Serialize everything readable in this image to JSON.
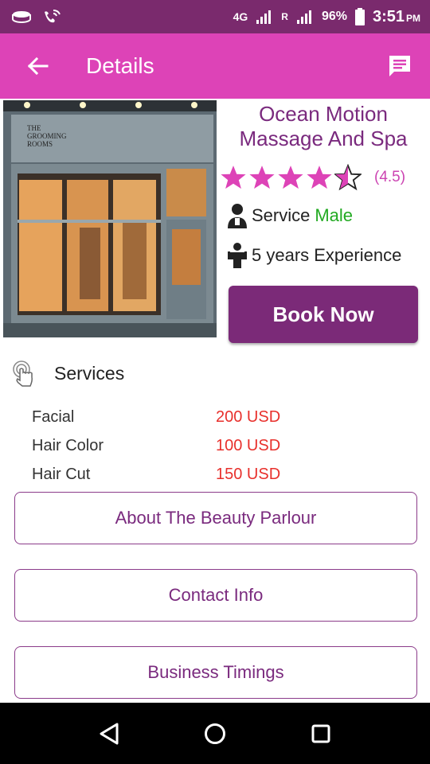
{
  "status_bar": {
    "network_type": "4G",
    "roaming_indicator": "R",
    "battery_percent": "96%",
    "time": "3:51",
    "time_suffix": "PM"
  },
  "app_bar": {
    "title": "Details",
    "back_icon": "arrow-left-icon",
    "chat_icon": "message-icon"
  },
  "shop": {
    "photo_sign_text": "THE GROOMING ROOMS",
    "name": "Ocean Motion Massage And Spa",
    "rating": 4.5,
    "rating_text": "(4.5)",
    "service_label": "Service",
    "service_gender": "Male",
    "experience": "5 years Experience",
    "book_label": "Book Now"
  },
  "services": {
    "title": "Services",
    "items": [
      {
        "name": "Facial",
        "price": "200 USD"
      },
      {
        "name": "Hair Color",
        "price": "100 USD"
      },
      {
        "name": "Hair Cut",
        "price": "150 USD"
      }
    ]
  },
  "buttons": {
    "about": "About The Beauty Parlour",
    "contact": "Contact Info",
    "timings": "Business Timings"
  },
  "colors": {
    "status_bar": "#7a2a6d",
    "app_bar": "#dd43b7",
    "primary": "#7b2a78",
    "star": "#dd43b7",
    "price": "#e8302c",
    "gender": "#22aa22"
  }
}
